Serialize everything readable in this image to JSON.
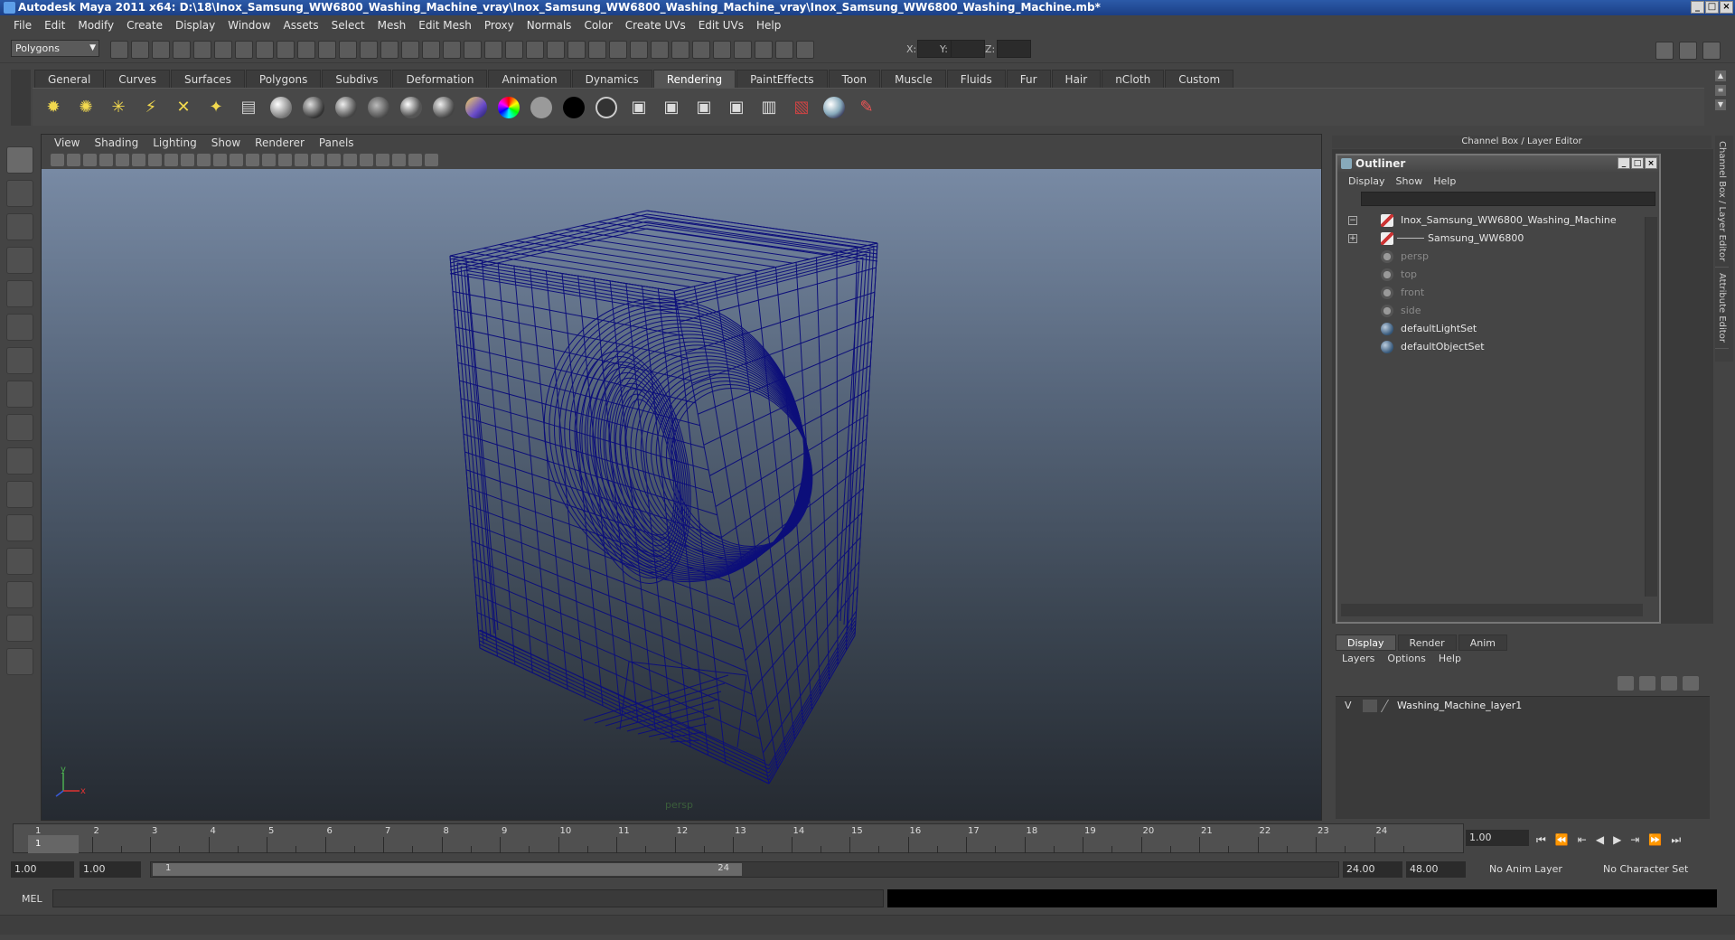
{
  "window": {
    "title": "Autodesk Maya 2011 x64: D:\\18\\Inox_Samsung_WW6800_Washing_Machine_vray\\Inox_Samsung_WW6800_Washing_Machine_vray\\Inox_Samsung_WW6800_Washing_Machine.mb*"
  },
  "menubar": [
    "File",
    "Edit",
    "Modify",
    "Create",
    "Display",
    "Window",
    "Assets",
    "Select",
    "Mesh",
    "Edit Mesh",
    "Proxy",
    "Normals",
    "Color",
    "Create UVs",
    "Edit UVs",
    "Help"
  ],
  "statusline": {
    "mode": "Polygons",
    "coord_labels": [
      "X:",
      "Y:",
      "Z:"
    ]
  },
  "shelf": {
    "tabs": [
      "General",
      "Curves",
      "Surfaces",
      "Polygons",
      "Subdivs",
      "Deformation",
      "Animation",
      "Dynamics",
      "Rendering",
      "PaintEffects",
      "Toon",
      "Muscle",
      "Fluids",
      "Fur",
      "Hair",
      "nCloth",
      "Custom"
    ],
    "active_tab": "Rendering"
  },
  "viewport": {
    "menu": [
      "View",
      "Shading",
      "Lighting",
      "Show",
      "Renderer",
      "Panels"
    ],
    "camera_label": "persp",
    "wire_color": "#0d0f7a"
  },
  "channel_box": {
    "header": "Channel Box / Layer Editor",
    "side_tabs": [
      "Channel Box / Layer Editor",
      "Attribute Editor"
    ]
  },
  "outliner": {
    "title": "Outliner",
    "menu": [
      "Display",
      "Show",
      "Help"
    ],
    "items": [
      {
        "label": "Inox_Samsung_WW6800_Washing_Machine",
        "expander": "−",
        "dim": false
      },
      {
        "label": "Samsung_WW6800",
        "expander": "+",
        "dim": false
      },
      {
        "label": "persp",
        "expander": "",
        "dim": true
      },
      {
        "label": "top",
        "expander": "",
        "dim": true
      },
      {
        "label": "front",
        "expander": "",
        "dim": true
      },
      {
        "label": "side",
        "expander": "",
        "dim": true
      },
      {
        "label": "defaultLightSet",
        "expander": "",
        "dim": false
      },
      {
        "label": "defaultObjectSet",
        "expander": "",
        "dim": false
      }
    ]
  },
  "layer_editor": {
    "tabs": [
      "Display",
      "Render",
      "Anim"
    ],
    "active_tab": "Display",
    "menu": [
      "Layers",
      "Options",
      "Help"
    ],
    "layers": [
      {
        "visible": "V",
        "name": "Washing_Machine_layer1"
      }
    ]
  },
  "time_slider": {
    "ticks": [
      "1",
      "2",
      "3",
      "4",
      "5",
      "6",
      "7",
      "8",
      "9",
      "10",
      "11",
      "12",
      "13",
      "14",
      "15",
      "16",
      "17",
      "18",
      "19",
      "20",
      "21",
      "22",
      "23",
      "24"
    ],
    "current_marker": "1",
    "current_frame": "1.00"
  },
  "range_slider": {
    "start": "1.00",
    "playback_start": "1.00",
    "handle_start": "1",
    "handle_end": "24",
    "playback_end": "24.00",
    "end": "48.00",
    "anim_layer": "No Anim Layer",
    "character_set": "No Character Set"
  },
  "command_line": {
    "label": "MEL"
  }
}
